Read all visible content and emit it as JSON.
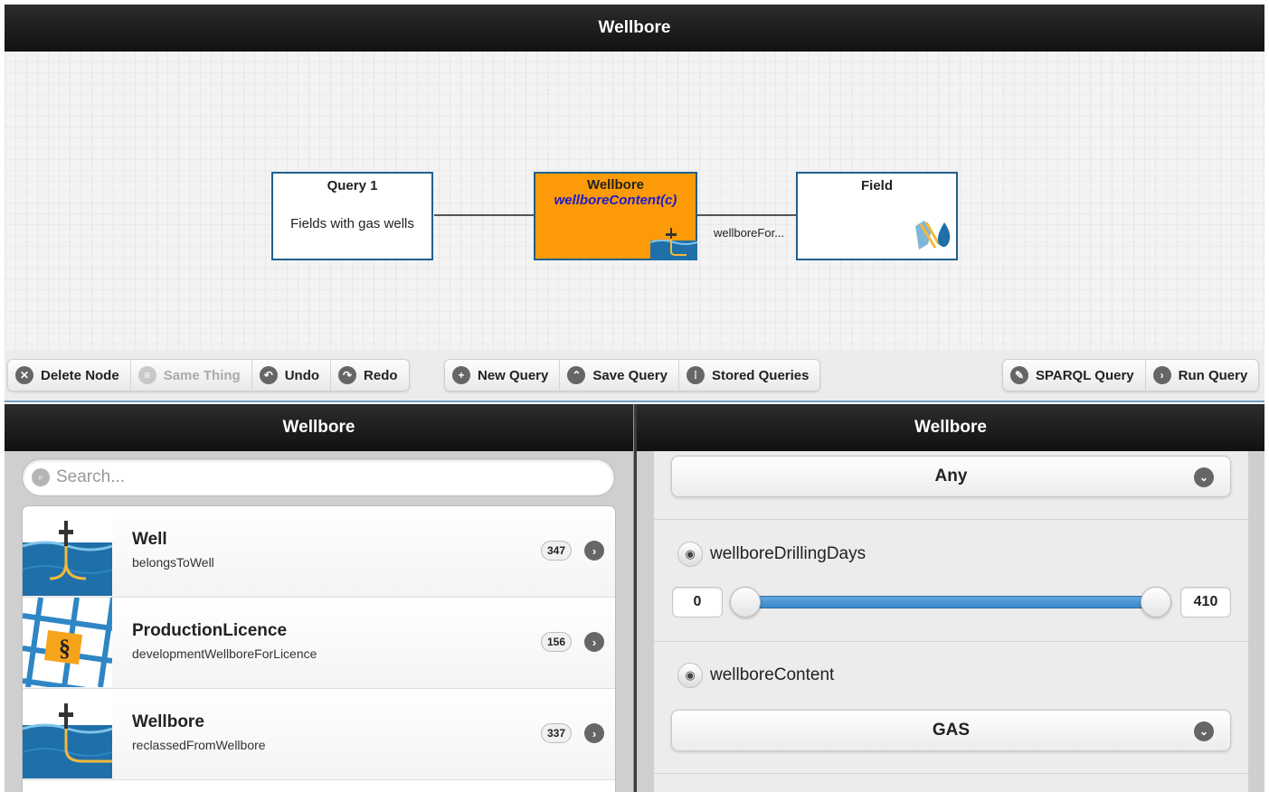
{
  "header": {
    "title": "Wellbore"
  },
  "graph": {
    "nodes": [
      {
        "title": "Query 1",
        "body": "Fields with gas wells"
      },
      {
        "title": "Wellbore",
        "subtitle": "wellboreContent(c)",
        "icon": "wellbore-icon"
      },
      {
        "title": "Field",
        "icon": "field-icon"
      }
    ],
    "edge_label": "wellboreFor..."
  },
  "toolbar": {
    "delete_node": "Delete Node",
    "same_thing": "Same Thing",
    "undo": "Undo",
    "redo": "Redo",
    "new_query": "New Query",
    "save_query": "Save Query",
    "stored_queries": "Stored Queries",
    "sparql_query": "SPARQL Query",
    "run_query": "Run Query"
  },
  "left_panel": {
    "title": "Wellbore",
    "search_placeholder": "Search...",
    "items": [
      {
        "title": "Well",
        "subtitle": "belongsToWell",
        "count": "347",
        "icon": "well-icon"
      },
      {
        "title": "ProductionLicence",
        "subtitle": "developmentWellboreForLicence",
        "count": "156",
        "icon": "licence-icon"
      },
      {
        "title": "Wellbore",
        "subtitle": "reclassedFromWellbore",
        "count": "337",
        "icon": "wellbore-icon"
      }
    ]
  },
  "right_panel": {
    "title": "Wellbore",
    "select_any": "Any",
    "facet1": {
      "label": "wellboreDrillingDays",
      "min": "0",
      "max": "410",
      "range_low": 0,
      "range_high": 410
    },
    "facet2": {
      "label": "wellboreContent",
      "value": "GAS"
    }
  },
  "colors": {
    "accent": "#fc9a07",
    "slider": "#3a87c8",
    "header": "#1a1a1a"
  }
}
